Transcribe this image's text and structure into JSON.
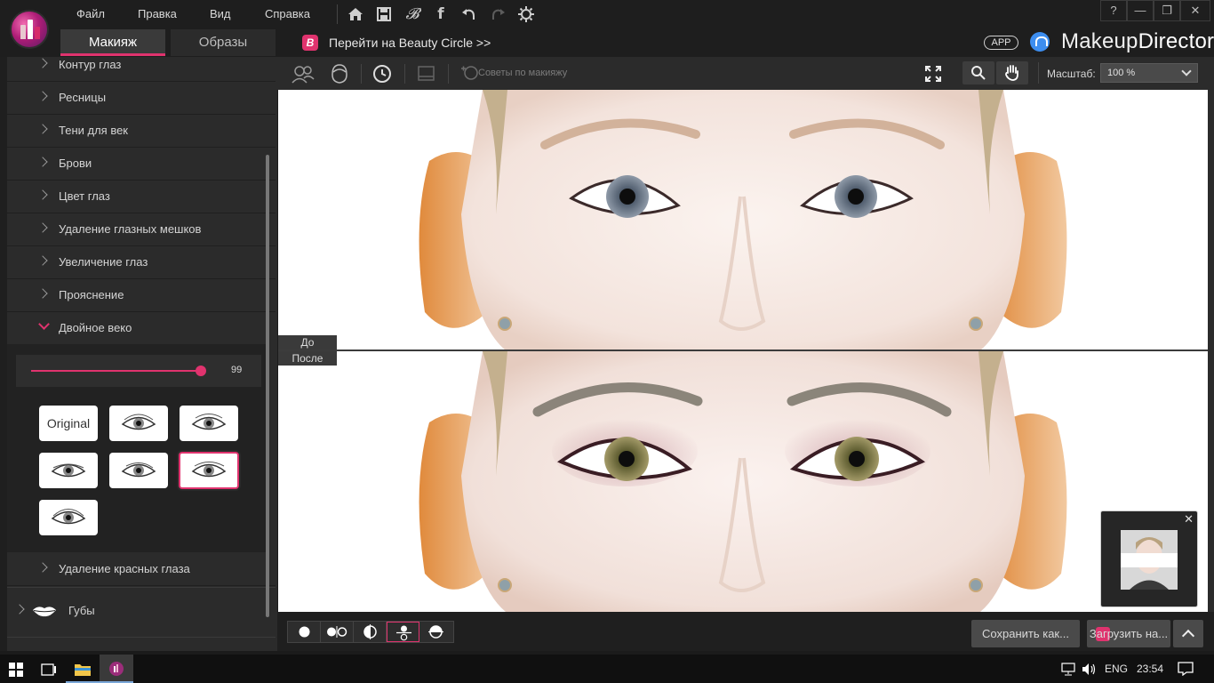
{
  "menu": {
    "items": [
      "Файл",
      "Правка",
      "Вид",
      "Справка"
    ]
  },
  "tabs": {
    "makeup": "Макияж",
    "looks": "Образы"
  },
  "beauty_circle": {
    "link": "Перейти на Beauty Circle >>"
  },
  "header": {
    "app_badge": "APP",
    "brand_part1": "Makeup",
    "brand_part2": "Director"
  },
  "window": {
    "help": "?",
    "minimize": "—",
    "restore": "❐",
    "close": "✕"
  },
  "sidebar": {
    "items": [
      "Контур глаз",
      "Ресницы",
      "Тени для век",
      "Брови",
      "Цвет глаз",
      "Удаление глазных мешков",
      "Увеличение глаз",
      "Прояснение",
      "Двойное веко",
      "Удаление красных глаза"
    ],
    "lips": "Губы",
    "slider_value": "99",
    "slider_level": 0.99,
    "original_tile": "Original",
    "selected_tile": 6
  },
  "toolbar": {
    "tips": "Советы по макияжу",
    "scale_label": "Масштаб:",
    "scale_value": "100 %"
  },
  "canvas": {
    "before_tag": "До",
    "after_tag": "После"
  },
  "navigator": {
    "close": "✕"
  },
  "bottom": {
    "save": "Сохранить как...",
    "upload": "Загрузить на..."
  },
  "taskbar": {
    "lang": "ENG",
    "time": "23:54"
  },
  "colors": {
    "accent": "#e0336e",
    "panel": "#2b2b2b",
    "dark": "#1e1e1e"
  }
}
